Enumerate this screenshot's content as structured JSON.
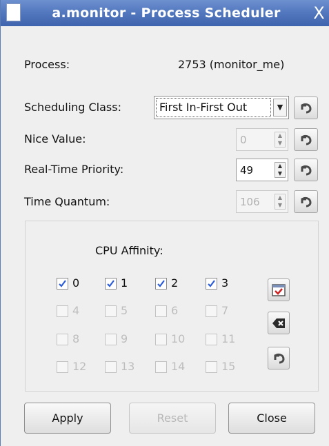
{
  "window": {
    "title": "a.monitor - Process Scheduler",
    "close_glyph": "X"
  },
  "process": {
    "label": "Process:",
    "value": "2753 (monitor_me)"
  },
  "scheduling_class": {
    "label": "Scheduling Class:",
    "value": "First In-First Out"
  },
  "nice_value": {
    "label": "Nice Value:",
    "value": "0",
    "enabled": false
  },
  "realtime_priority": {
    "label": "Real-Time Priority:",
    "value": "49",
    "enabled": true
  },
  "time_quantum": {
    "label": "Time Quantum:",
    "value": "106",
    "enabled": false
  },
  "cpu_affinity": {
    "title": "CPU Affinity:",
    "cpus": [
      {
        "label": "0",
        "checked": true,
        "enabled": true
      },
      {
        "label": "1",
        "checked": true,
        "enabled": true
      },
      {
        "label": "2",
        "checked": true,
        "enabled": true
      },
      {
        "label": "3",
        "checked": true,
        "enabled": true
      },
      {
        "label": "4",
        "checked": false,
        "enabled": false
      },
      {
        "label": "5",
        "checked": false,
        "enabled": false
      },
      {
        "label": "6",
        "checked": false,
        "enabled": false
      },
      {
        "label": "7",
        "checked": false,
        "enabled": false
      },
      {
        "label": "8",
        "checked": false,
        "enabled": false
      },
      {
        "label": "9",
        "checked": false,
        "enabled": false
      },
      {
        "label": "10",
        "checked": false,
        "enabled": false
      },
      {
        "label": "11",
        "checked": false,
        "enabled": false
      },
      {
        "label": "12",
        "checked": false,
        "enabled": false
      },
      {
        "label": "13",
        "checked": false,
        "enabled": false
      },
      {
        "label": "14",
        "checked": false,
        "enabled": false
      },
      {
        "label": "15",
        "checked": false,
        "enabled": false
      }
    ]
  },
  "buttons": {
    "apply": "Apply",
    "reset": "Reset",
    "close": "Close"
  },
  "icons": {
    "reset": "undo-arrow-icon",
    "select_all": "select-all-icon",
    "clear": "backspace-clear-icon"
  },
  "colors": {
    "titlebar": "#5479bf",
    "checkmark": "#2a5bd7",
    "window_bg": "#efefef"
  }
}
